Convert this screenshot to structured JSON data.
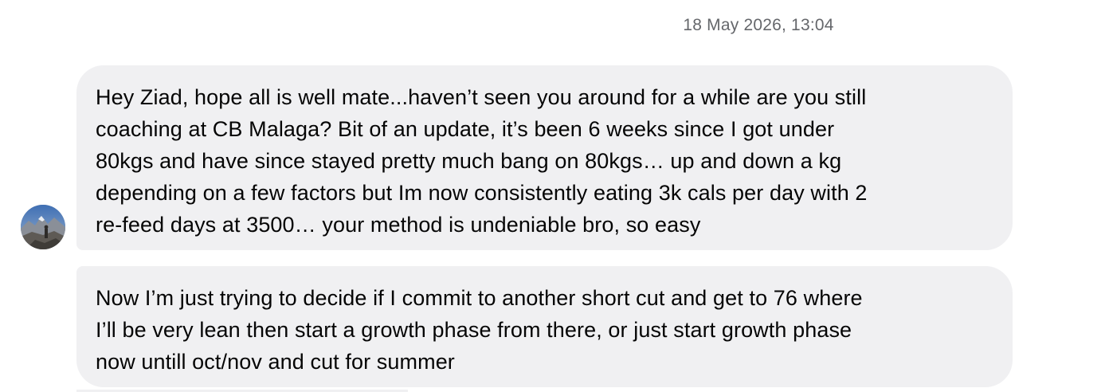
{
  "thread": {
    "timestamp": "18 May 2026, 13:04"
  },
  "messages": [
    {
      "lines": [
        "Hey Ziad, hope all is well mate...haven’t seen you around for a while are you still",
        "coaching at CB Malaga? Bit of an update, it’s been 6 weeks since I got under",
        "80kgs and have since stayed pretty much bang on 80kgs… up and down a kg",
        "depending on a few factors but Im now consistently eating 3k cals per day with 2",
        "re-feed days at 3500… your method is undeniable bro, so easy"
      ]
    },
    {
      "lines": [
        "Now I’m just trying to decide if I commit to another short cut and get to 76 where",
        "I’ll be very lean then start a growth phase from there, or just start growth phase",
        "now untill oct/nov and cut for summer"
      ]
    }
  ],
  "colors": {
    "bubble_background": "#f0f0f2",
    "text": "#050505",
    "timestamp_text": "#65676b"
  }
}
